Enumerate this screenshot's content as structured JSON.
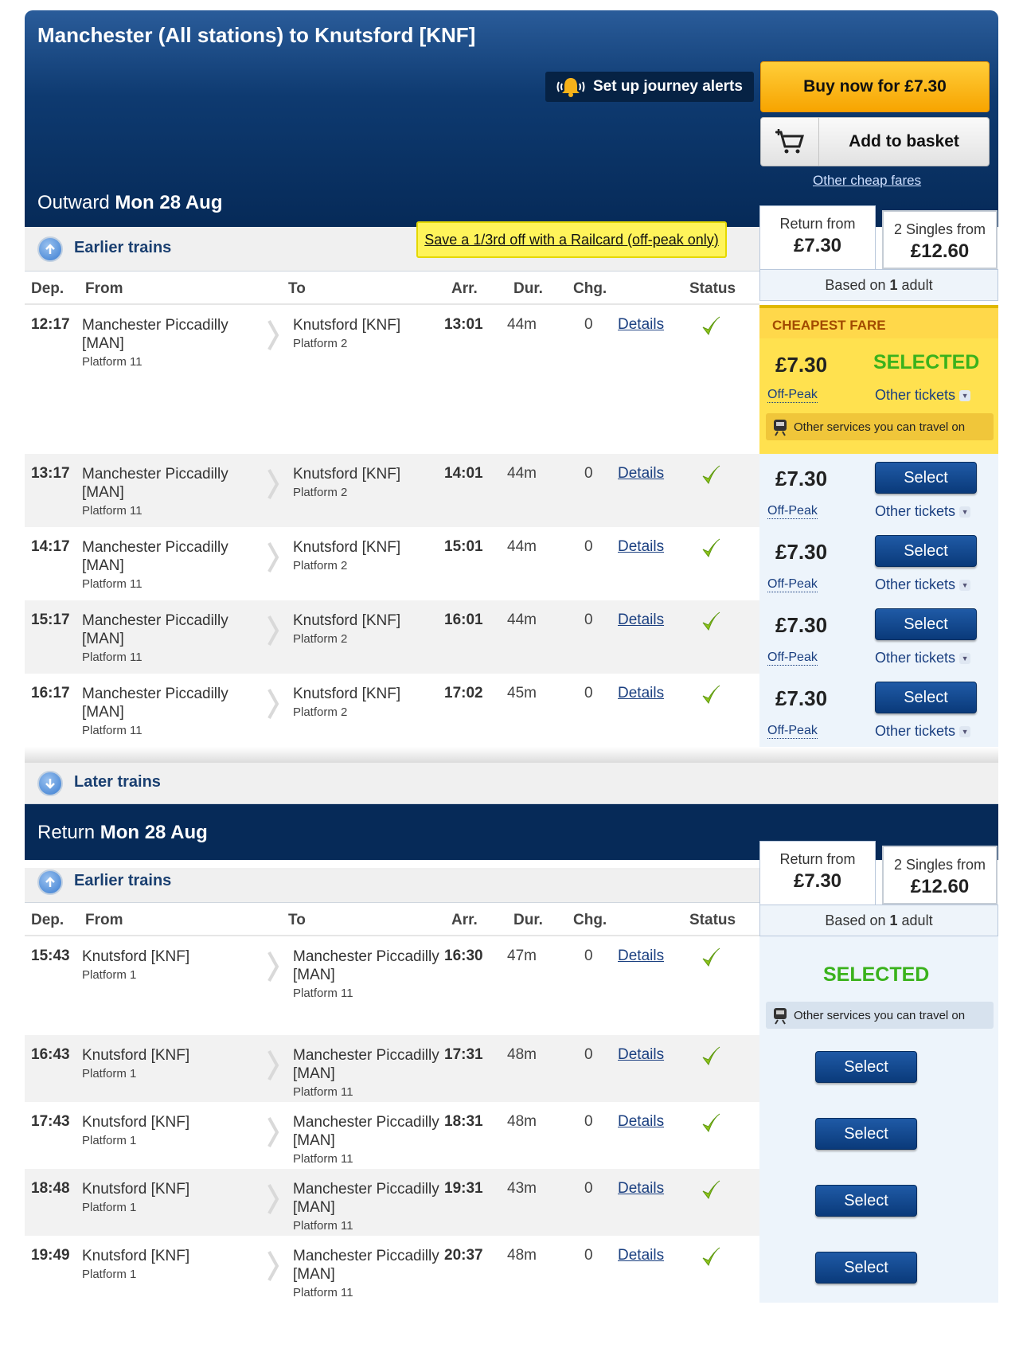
{
  "header": {
    "title": "Manchester (All stations) to Knutsford [KNF]",
    "alerts_label": "Set up journey alerts",
    "buy_label": "Buy now for £7.30",
    "basket_label": "Add to basket",
    "cheap_fares_link": "Other cheap fares",
    "outward_prefix": "Outward",
    "outward_date": "Mon 28 Aug"
  },
  "fare_header": {
    "return_from": "Return from",
    "return_price": "£7.30",
    "singles_from": "2 Singles from",
    "singles_price": "£12.60",
    "based_on_prefix": "Based on",
    "based_on_count": "1",
    "based_on_suffix": "adult"
  },
  "outward": {
    "earlier_label": "Earlier trains",
    "later_label": "Later trains",
    "railcard_label": "Save a 1/3rd off with a Railcard (off-peak only)",
    "columns": [
      "Dep.",
      "From",
      "To",
      "Arr.",
      "Dur.",
      "Chg.",
      "Status"
    ],
    "cheapest_label": "CHEAPEST FARE",
    "selected_label": "SELECTED",
    "services_label": "Other services you can travel on",
    "offpeak_label": "Off-Peak",
    "other_tickets_label": "Other tickets",
    "select_label": "Select",
    "details_label": "Details",
    "rows": [
      {
        "dep": "12:17",
        "from": "Manchester Piccadilly [MAN]",
        "from_plat": "Platform 11",
        "to": "Knutsford [KNF]",
        "to_plat": "Platform 2",
        "arr": "13:01",
        "dur": "44m",
        "chg": "0",
        "price": "£7.30"
      },
      {
        "dep": "13:17",
        "from": "Manchester Piccadilly [MAN]",
        "from_plat": "Platform 11",
        "to": "Knutsford [KNF]",
        "to_plat": "Platform 2",
        "arr": "14:01",
        "dur": "44m",
        "chg": "0",
        "price": "£7.30"
      },
      {
        "dep": "14:17",
        "from": "Manchester Piccadilly [MAN]",
        "from_plat": "Platform 11",
        "to": "Knutsford [KNF]",
        "to_plat": "Platform 2",
        "arr": "15:01",
        "dur": "44m",
        "chg": "0",
        "price": "£7.30"
      },
      {
        "dep": "15:17",
        "from": "Manchester Piccadilly [MAN]",
        "from_plat": "Platform 11",
        "to": "Knutsford [KNF]",
        "to_plat": "Platform 2",
        "arr": "16:01",
        "dur": "44m",
        "chg": "0",
        "price": "£7.30"
      },
      {
        "dep": "16:17",
        "from": "Manchester Piccadilly [MAN]",
        "from_plat": "Platform 11",
        "to": "Knutsford [KNF]",
        "to_plat": "Platform 2",
        "arr": "17:02",
        "dur": "45m",
        "chg": "0",
        "price": "£7.30"
      }
    ]
  },
  "return": {
    "prefix": "Return",
    "date": "Mon 28 Aug",
    "earlier_label": "Earlier trains",
    "rows": [
      {
        "dep": "15:43",
        "from": "Knutsford [KNF]",
        "from_plat": "Platform 1",
        "to": "Manchester Piccadilly [MAN]",
        "to_plat": "Platform 11",
        "arr": "16:30",
        "dur": "47m",
        "chg": "0"
      },
      {
        "dep": "16:43",
        "from": "Knutsford [KNF]",
        "from_plat": "Platform 1",
        "to": "Manchester Piccadilly [MAN]",
        "to_plat": "Platform 11",
        "arr": "17:31",
        "dur": "48m",
        "chg": "0"
      },
      {
        "dep": "17:43",
        "from": "Knutsford [KNF]",
        "from_plat": "Platform 1",
        "to": "Manchester Piccadilly [MAN]",
        "to_plat": "Platform 11",
        "arr": "18:31",
        "dur": "48m",
        "chg": "0"
      },
      {
        "dep": "18:48",
        "from": "Knutsford [KNF]",
        "from_plat": "Platform 1",
        "to": "Manchester Piccadilly [MAN]",
        "to_plat": "Platform 11",
        "arr": "19:31",
        "dur": "43m",
        "chg": "0"
      },
      {
        "dep": "19:49",
        "from": "Knutsford [KNF]",
        "from_plat": "Platform 1",
        "to": "Manchester Piccadilly [MAN]",
        "to_plat": "Platform 11",
        "arr": "20:37",
        "dur": "48m",
        "chg": "0"
      }
    ]
  },
  "colors": {
    "accent": "#062a58",
    "buy": "#f7a400",
    "selected": "#3ab21c",
    "cheapest_bg": "#ffe14f"
  }
}
